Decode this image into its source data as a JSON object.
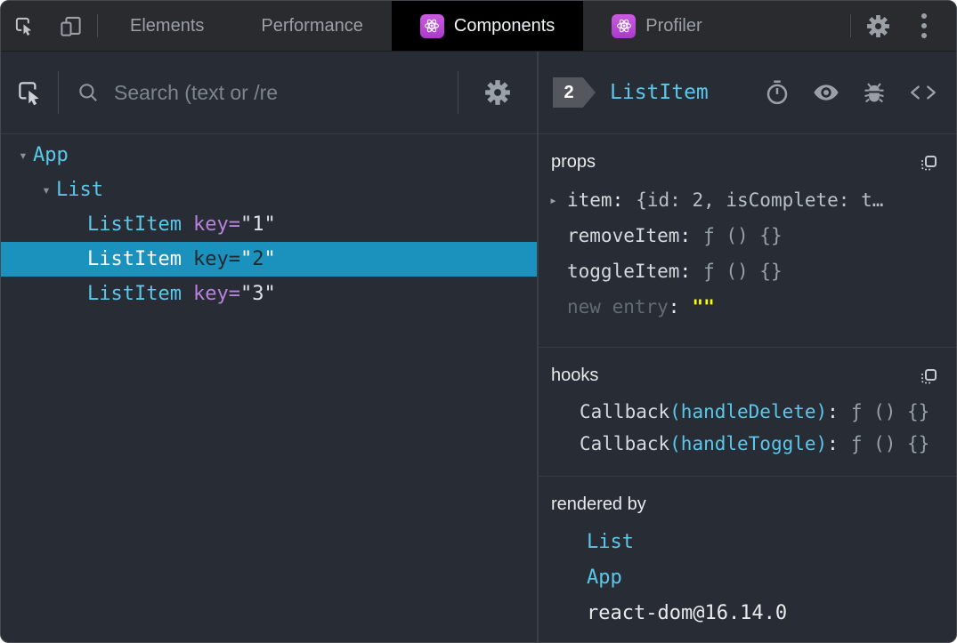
{
  "topbar": {
    "tabs": [
      {
        "label": "Elements"
      },
      {
        "label": "Performance"
      },
      {
        "label": "Components"
      },
      {
        "label": "Profiler"
      }
    ]
  },
  "left": {
    "search": {
      "placeholder": "Search (text or /re"
    },
    "tree": {
      "rows": [
        {
          "arrow": "▾",
          "name": "App"
        },
        {
          "arrow": "▾",
          "name": "List"
        },
        {
          "name": "ListItem",
          "attr_name": "key",
          "eq": "=",
          "open_quote": "\"",
          "value": "1",
          "close_quote": "\""
        },
        {
          "name": "ListItem",
          "attr_name": "key",
          "eq": "=",
          "open_quote": "\"",
          "value": "2",
          "close_quote": "\""
        },
        {
          "name": "ListItem",
          "attr_name": "key",
          "eq": "=",
          "open_quote": "\"",
          "value": "3",
          "close_quote": "\""
        }
      ]
    }
  },
  "right": {
    "header": {
      "badge": "2",
      "title": "ListItem"
    },
    "colon": ":",
    "expand_arrow": "▸",
    "props": {
      "title": "props",
      "rows": [
        {
          "name": "item",
          "value": "{id: 2, isComplete: t…"
        },
        {
          "name": "removeItem",
          "value": "ƒ () {}"
        },
        {
          "name": "toggleItem",
          "value": "ƒ () {}"
        },
        {
          "name": "new entry",
          "value": "\"\""
        }
      ]
    },
    "hooks": {
      "title": "hooks",
      "rows": [
        {
          "prefix": "Callback",
          "fn": "(handleDelete)",
          "value": "ƒ () {}"
        },
        {
          "prefix": "Callback",
          "fn": "(handleToggle)",
          "value": "ƒ () {}"
        }
      ]
    },
    "rendered_by": {
      "title": "rendered by",
      "items": [
        "List",
        "App",
        "react-dom@16.14.0"
      ]
    }
  },
  "colors": {
    "accent_cyan": "#5bc7ea",
    "selection_blue": "#1b92bd",
    "attribute_purple": "#b982dc",
    "editable_yellow": "#ffff00",
    "react_brand_purple": "#b944d4"
  }
}
